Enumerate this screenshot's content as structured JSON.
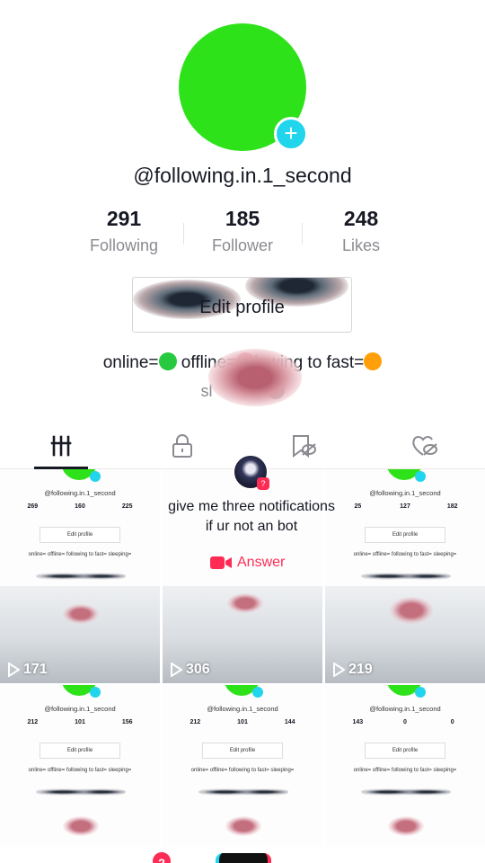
{
  "profile": {
    "username": "@following.in.1_second",
    "add_icon": "plus-icon",
    "stats": [
      {
        "value": "291",
        "label": "Following"
      },
      {
        "value": "185",
        "label": "Follower"
      },
      {
        "value": "248",
        "label": "Likes"
      }
    ],
    "edit_profile": "Edit profile",
    "bio_line1_a": "online=",
    "bio_line1_b": " offline=",
    "bio_line1_c": "lowing to fast=",
    "bio_line2": "sl",
    "status_colors": {
      "online": "#27c93f",
      "offline": "#fe2c55",
      "following": "#ff9f0a",
      "sleeping": "#333333"
    }
  },
  "tabs": [
    {
      "icon": "grid-icon"
    },
    {
      "icon": "lock-icon"
    },
    {
      "icon": "bookmark-hidden-icon"
    },
    {
      "icon": "liked-hidden-icon"
    }
  ],
  "videos": [
    {
      "views": "171",
      "mini": {
        "user": "@following.in.1_second",
        "s1": "269",
        "s2": "160",
        "s3": "225"
      }
    },
    {
      "views": "306",
      "mini": {
        "user": "",
        "s1": "",
        "s2": "",
        "s3": ""
      }
    },
    {
      "views": "219",
      "mini": {
        "user": "@following.in.1_second",
        "s1": "25",
        "s2": "127",
        "s3": "182"
      }
    },
    {
      "views": "",
      "mini": {
        "user": "@following.in.1_second",
        "s1": "212",
        "s2": "101",
        "s3": "156"
      }
    },
    {
      "views": "",
      "mini": {
        "user": "@following.in.1_second",
        "s1": "212",
        "s2": "101",
        "s3": "144"
      }
    },
    {
      "views": "",
      "mini": {
        "user": "@following.in.1_second",
        "s1": "143",
        "s2": "0",
        "s3": "0"
      }
    }
  ],
  "mini_labels": {
    "edit": "Edit profile",
    "bio": "online= offline= following to fast= sleeping="
  },
  "comment": {
    "text": "give me three notifications\nif ur not an bot",
    "badge": "?",
    "answer_label": "Answer",
    "answer_icon": "video-camera-icon"
  },
  "bottom_nav": {
    "inbox_badge": "2"
  },
  "colors": {
    "accent": "#fe2c55",
    "avatar_green": "#2ee21a",
    "cyan": "#20d5ec"
  }
}
